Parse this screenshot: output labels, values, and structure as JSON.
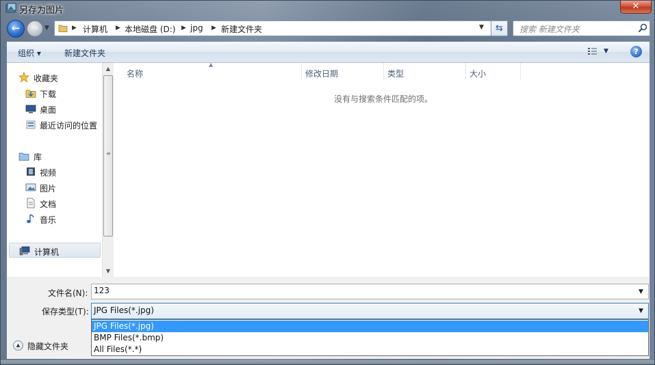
{
  "window": {
    "title": "另存为图片",
    "close_label": "✕"
  },
  "address_bar": {
    "breadcrumbs": [
      "计算机",
      "本地磁盘 (D:)",
      "jpg",
      "新建文件夹"
    ]
  },
  "search": {
    "placeholder": "搜索 新建文件夹"
  },
  "toolbar": {
    "organize_label": "组织 ▾",
    "new_folder_label": "新建文件夹",
    "help_label": "?"
  },
  "nav": {
    "favorites": {
      "label": "收藏夹",
      "items": [
        "下载",
        "桌面",
        "最近访问的位置"
      ]
    },
    "libraries": {
      "label": "库",
      "items": [
        "视频",
        "图片",
        "文档",
        "音乐"
      ]
    },
    "computer": {
      "label": "计算机"
    }
  },
  "file_list": {
    "columns": [
      "名称",
      "修改日期",
      "类型",
      "大小"
    ],
    "empty_message": "没有与搜索条件匹配的项。"
  },
  "form": {
    "filename_label": "文件名(N):",
    "filename_value": "123",
    "filetype_label": "保存类型(T):",
    "filetype_value": "JPG Files(*.jpg)",
    "filetype_options": [
      "JPG Files(*.jpg)",
      "BMP Files(*.bmp)",
      "All Files(*.*)"
    ],
    "hide_folders_label": "隐藏文件夹"
  },
  "colors": {
    "selection": "#3399ff",
    "close_button": "#c0371c",
    "accent_text": "#1e395b"
  }
}
